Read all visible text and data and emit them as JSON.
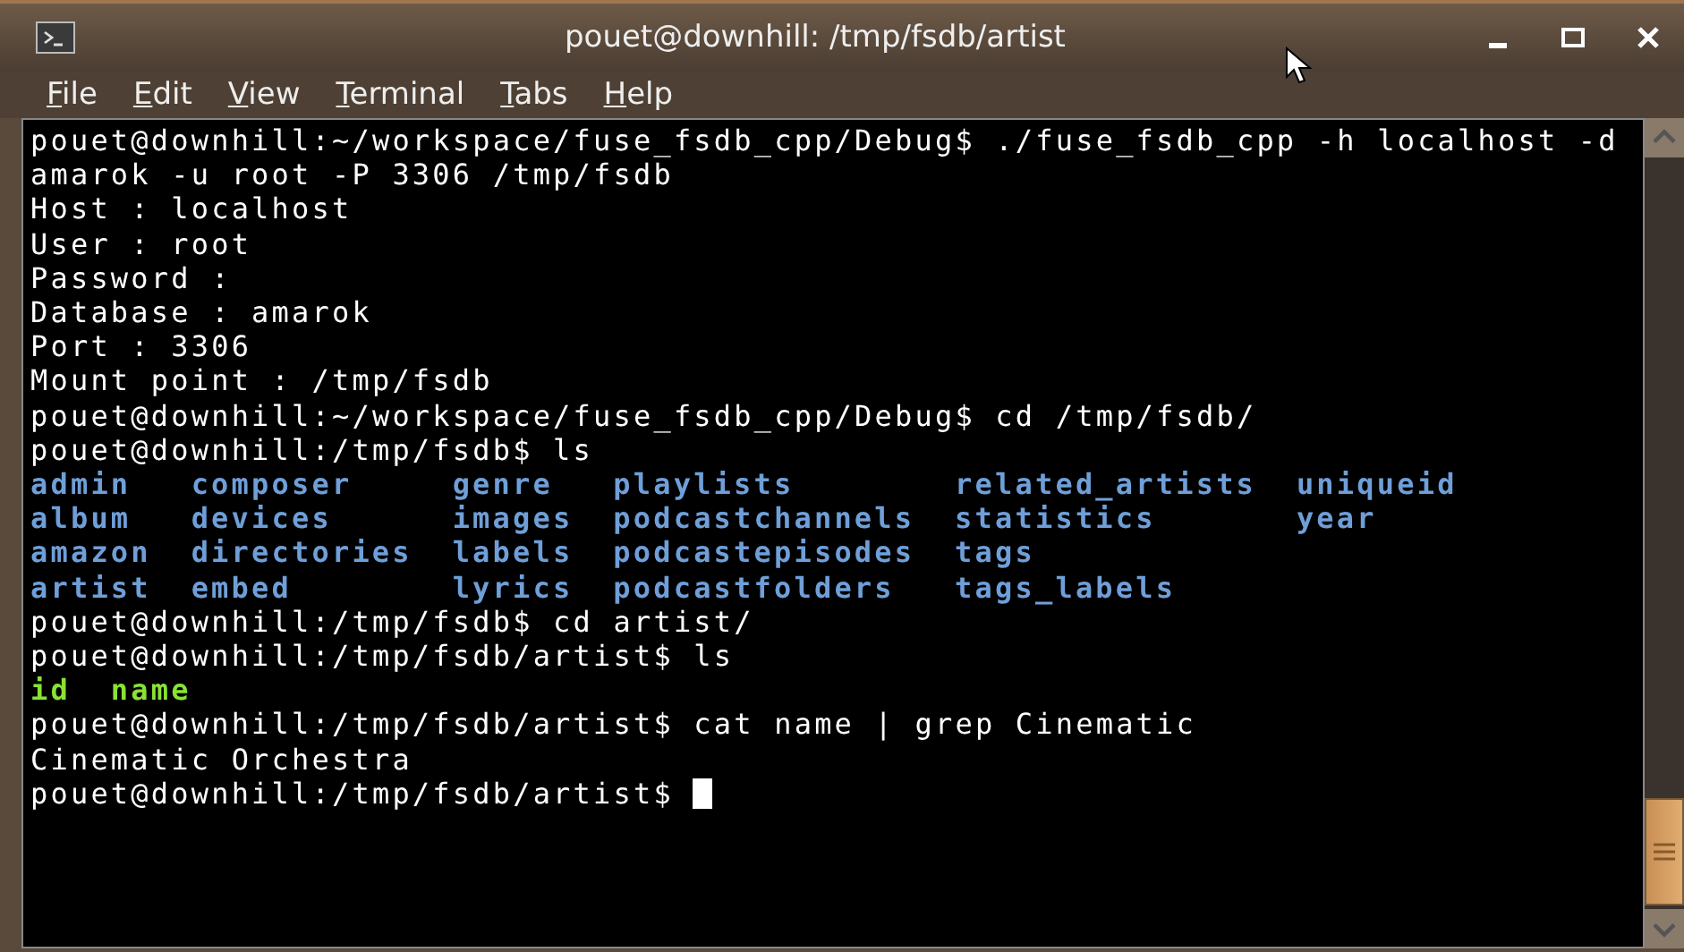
{
  "window": {
    "title": "pouet@downhill: /tmp/fsdb/artist"
  },
  "menu": [
    {
      "label": "File",
      "first_letter_underlined": true
    },
    {
      "label": "Edit",
      "first_letter_underlined": true
    },
    {
      "label": "View",
      "first_letter_underlined": true
    },
    {
      "label": "Terminal",
      "first_letter_underlined": true
    },
    {
      "label": "Tabs",
      "first_letter_underlined": true
    },
    {
      "label": "Help",
      "first_letter_underlined": true
    }
  ],
  "terminal": {
    "lines": [
      {
        "kind": "text",
        "text": "pouet@downhill:~/workspace/fuse_fsdb_cpp/Debug$ ./fuse_fsdb_cpp -h localhost -d"
      },
      {
        "kind": "text",
        "text": "amarok -u root -P 3306 /tmp/fsdb"
      },
      {
        "kind": "text",
        "text": "Host : localhost"
      },
      {
        "kind": "text",
        "text": "User : root"
      },
      {
        "kind": "text",
        "text": "Password :"
      },
      {
        "kind": "text",
        "text": "Database : amarok"
      },
      {
        "kind": "text",
        "text": "Port : 3306"
      },
      {
        "kind": "text",
        "text": "Mount point : /tmp/fsdb"
      },
      {
        "kind": "text",
        "text": "pouet@downhill:~/workspace/fuse_fsdb_cpp/Debug$ cd /tmp/fsdb/"
      },
      {
        "kind": "text",
        "text": "pouet@downhill:/tmp/fsdb$ ls"
      },
      {
        "kind": "listing",
        "columns": [
          [
            {
              "name": "admin",
              "kind": "dir"
            },
            {
              "name": "album",
              "kind": "dir"
            },
            {
              "name": "amazon",
              "kind": "dir"
            },
            {
              "name": "artist",
              "kind": "dir"
            }
          ],
          [
            {
              "name": "composer",
              "kind": "dir"
            },
            {
              "name": "devices",
              "kind": "dir"
            },
            {
              "name": "directories",
              "kind": "dir"
            },
            {
              "name": "embed",
              "kind": "dir"
            }
          ],
          [
            {
              "name": "genre",
              "kind": "dir"
            },
            {
              "name": "images",
              "kind": "dir"
            },
            {
              "name": "labels",
              "kind": "dir"
            },
            {
              "name": "lyrics",
              "kind": "dir"
            }
          ],
          [
            {
              "name": "playlists",
              "kind": "dir"
            },
            {
              "name": "podcastchannels",
              "kind": "dir"
            },
            {
              "name": "podcastepisodes",
              "kind": "dir"
            },
            {
              "name": "podcastfolders",
              "kind": "dir"
            }
          ],
          [
            {
              "name": "related_artists",
              "kind": "dir"
            },
            {
              "name": "statistics",
              "kind": "dir"
            },
            {
              "name": "tags",
              "kind": "dir"
            },
            {
              "name": "tags_labels",
              "kind": "dir"
            }
          ],
          [
            {
              "name": "uniqueid",
              "kind": "dir"
            },
            {
              "name": "year",
              "kind": "dir"
            }
          ]
        ]
      },
      {
        "kind": "text",
        "text": "pouet@downhill:/tmp/fsdb$ cd artist/"
      },
      {
        "kind": "text",
        "text": "pouet@downhill:/tmp/fsdb/artist$ ls"
      },
      {
        "kind": "listing",
        "columns": [
          [
            {
              "name": "id",
              "kind": "file"
            }
          ],
          [
            {
              "name": "name",
              "kind": "file"
            }
          ]
        ]
      },
      {
        "kind": "text",
        "text": "pouet@downhill:/tmp/fsdb/artist$ cat name | grep Cinematic"
      },
      {
        "kind": "text",
        "text": "Cinematic Orchestra"
      },
      {
        "kind": "prompt",
        "text": "pouet@downhill:/tmp/fsdb/artist$"
      }
    ]
  }
}
